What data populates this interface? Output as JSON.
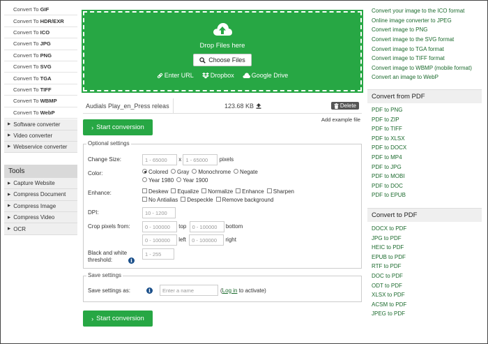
{
  "left_sidebar": {
    "convert_to": [
      {
        "prefix": "Convert To",
        "fmt": "GIF"
      },
      {
        "prefix": "Convert To",
        "fmt": "HDR/EXR"
      },
      {
        "prefix": "Convert To",
        "fmt": "ICO"
      },
      {
        "prefix": "Convert To",
        "fmt": "JPG"
      },
      {
        "prefix": "Convert To",
        "fmt": "PNG"
      },
      {
        "prefix": "Convert To",
        "fmt": "SVG"
      },
      {
        "prefix": "Convert To",
        "fmt": "TGA"
      },
      {
        "prefix": "Convert To",
        "fmt": "TIFF"
      },
      {
        "prefix": "Convert To",
        "fmt": "WBMP"
      },
      {
        "prefix": "Convert To",
        "fmt": "WebP"
      }
    ],
    "groups": [
      "Software converter",
      "Video converter",
      "Webservice converter"
    ],
    "tools_heading": "Tools",
    "tools": [
      "Capture Website",
      "Compress Document",
      "Compress Image",
      "Compress Video",
      "OCR"
    ]
  },
  "upload": {
    "drop_text": "Drop Files here",
    "choose_label": "Choose Files",
    "enter_url": "Enter URL",
    "dropbox": "Dropbox",
    "google_drive": "Google Drive"
  },
  "file": {
    "name": "Audials Play_en_Press releas",
    "size": "123.68 KB",
    "delete_label": "Delete"
  },
  "start_label": "Start conversion",
  "add_example": "Add example file",
  "optional": {
    "legend": "Optional settings",
    "change_size_label": "Change Size:",
    "size_w_placeholder": "1 - 65000",
    "size_x": "x",
    "size_h_placeholder": "1 - 65000",
    "size_unit": "pixels",
    "color_label": "Color:",
    "color_options": [
      "Colored",
      "Gray",
      "Monochrome",
      "Negate",
      "Year 1980",
      "Year 1900"
    ],
    "enhance_label": "Enhance:",
    "enhance_options": [
      "Deskew",
      "Equalize",
      "Normalize",
      "Enhance",
      "Sharpen",
      "No Antialias",
      "Despeckle",
      "Remove background"
    ],
    "dpi_label": "DPI:",
    "dpi_placeholder": "10 - 1200",
    "crop_label": "Crop pixels from:",
    "crop_placeholder": "0 - 100000",
    "crop_top": "top",
    "crop_bottom": "bottom",
    "crop_left": "left",
    "crop_right": "right",
    "bw_label": "Black and white threshold:",
    "bw_placeholder": "1 - 255"
  },
  "save": {
    "legend": "Save settings",
    "label": "Save settings as:",
    "placeholder": "Enter a name",
    "paren_open": "(",
    "login": "Log in",
    "suffix": " to activate)"
  },
  "right_sidebar": {
    "top_links": [
      "Convert your image to the ICO format",
      "Online image converter to JPEG",
      "Convert image to PNG",
      "Convert image to the SVG format",
      "Convert image to TGA format",
      "Convert image to TIFF format",
      "Convert image to WBMP (mobile format)",
      "Convert an image to WebP"
    ],
    "from_pdf_heading": "Convert from PDF",
    "from_pdf": [
      "PDF to PNG",
      "PDF to ZIP",
      "PDF to TIFF",
      "PDF to XLSX",
      "PDF to DOCX",
      "PDF to MP4",
      "PDF to JPG",
      "PDF to MOBI",
      "PDF to DOC",
      "PDF to EPUB"
    ],
    "to_pdf_heading": "Convert to PDF",
    "to_pdf": [
      "DOCX to PDF",
      "JPG to PDF",
      "HEIC to PDF",
      "EPUB to PDF",
      "RTF to PDF",
      "DOC to PDF",
      "ODT to PDF",
      "XLSX to PDF",
      "ACSM to PDF",
      "JPEG to PDF"
    ]
  }
}
